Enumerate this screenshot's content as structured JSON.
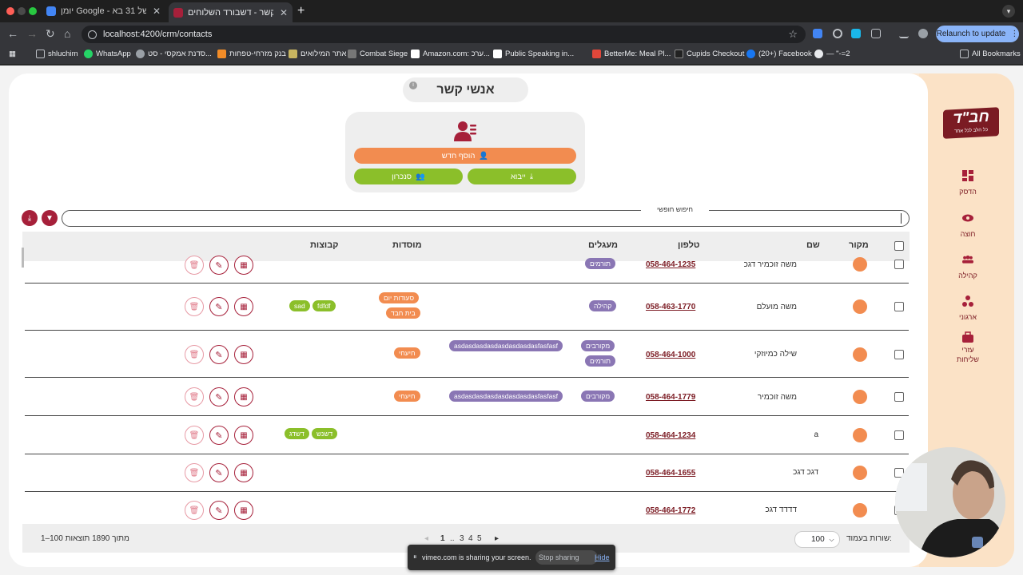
{
  "browser": {
    "tabs": [
      {
        "title": "יומן Google - השבוע של 31 בא...",
        "active": false
      },
      {
        "title": "אנשי קשר - דשבורד השלוחים",
        "active": true
      }
    ],
    "new_tab": "+",
    "url": "localhost:4200/crm/contacts",
    "relaunch_label": "Relaunch to update",
    "bookmarks": [
      "shluchim",
      "WhatsApp",
      "סדנת אמקסי - סט...",
      "בנק מזרחי-טפחות",
      "אתר המילואים",
      "Combat Siege",
      "Amazon.com: ערכ...",
      "Public Speaking in...",
      "BetterMe: Meal Pl...",
      "Cupids Checkout",
      "(20+) Facebook",
      "— \"-=2",
      "All Bookmarks"
    ]
  },
  "sidebar": {
    "logo_title": "חב\"ד",
    "logo_subtitle": "כל הלב לכל אחד",
    "items": [
      {
        "label": "הדסק",
        "icon": "dashboard-icon"
      },
      {
        "label": "חוצה",
        "icon": "eye-icon"
      },
      {
        "label": "קהילה",
        "icon": "community-icon"
      },
      {
        "label": "ארגוני",
        "icon": "organization-icon"
      },
      {
        "label": "עזרי שליחות",
        "icon": "briefcase-icon"
      }
    ]
  },
  "page": {
    "title": "אנשי קשר",
    "add_new_label": "הוסף חדש",
    "import_label": "ייבוא",
    "sync_label": "סנכרון",
    "search_label": "חיפוש חופשי"
  },
  "table": {
    "headers": {
      "source": "מקור",
      "name": "שם",
      "phone": "טלפון",
      "circles": "מעגלים",
      "institutions": "מוסדות",
      "groups": "קבוצות"
    },
    "rows": [
      {
        "name": "משה זוכמיר דגכ",
        "phone": "058-464-1235",
        "circles": [
          "תורמים"
        ],
        "institutions": [],
        "groups": []
      },
      {
        "name": "משה מועלם",
        "phone": "058-463-1770",
        "circles": [
          "קהילה"
        ],
        "institutions": [
          "סעודות יום",
          "בית חבד"
        ],
        "groups": [
          "fdfdf",
          "sad"
        ]
      },
      {
        "name": "שילה כמיוזקי",
        "phone": "058-464-1000",
        "circles": [
          "מקורבים",
          "asdasdasdasdasdasdasdasfasfasf",
          "תורמים"
        ],
        "institutions": [
          "חיעחי"
        ],
        "groups": []
      },
      {
        "name": "משה זוכמיר",
        "phone": "058-464-1779",
        "circles": [
          "מקורבים",
          "asdasdasdasdasdasdasdasfasfasf"
        ],
        "institutions": [
          "חיעחי"
        ],
        "groups": []
      },
      {
        "name": "a",
        "phone": "058-464-1234",
        "circles": [],
        "institutions": [],
        "groups": [
          "דשנש",
          "דשדג"
        ]
      },
      {
        "name": "דגכ דגכ",
        "phone": "058-464-1655",
        "circles": [],
        "institutions": [],
        "groups": []
      },
      {
        "name": "דדדד דגכ",
        "phone": "058-464-1772",
        "circles": [],
        "institutions": [],
        "groups": []
      }
    ]
  },
  "footer": {
    "rows_per_page_label": "שורות בעמוד:",
    "rows_per_page_value": "100",
    "pages": [
      "1",
      "..",
      "3",
      "4",
      "5"
    ],
    "range_text": "1–100 מתוך 1890 תוצאות"
  },
  "screen_share": {
    "text": "vimeo.com is sharing your screen.",
    "stop_label": "Stop sharing",
    "hide_label": "Hide"
  },
  "colors": {
    "brand": "#7b1b23",
    "accent_orange": "#f28c50",
    "accent_green": "#8bbf2a",
    "tag_purple": "#8a76b4"
  }
}
